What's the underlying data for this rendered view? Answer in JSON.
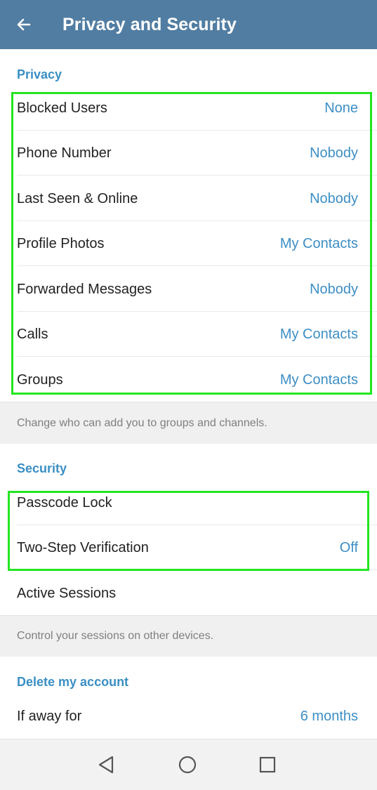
{
  "header": {
    "title": "Privacy and Security",
    "back_icon": "arrow-left-icon"
  },
  "privacy": {
    "title": "Privacy",
    "items": [
      {
        "label": "Blocked Users",
        "value": "None"
      },
      {
        "label": "Phone Number",
        "value": "Nobody"
      },
      {
        "label": "Last Seen & Online",
        "value": "Nobody"
      },
      {
        "label": "Profile Photos",
        "value": "My Contacts"
      },
      {
        "label": "Forwarded Messages",
        "value": "Nobody"
      },
      {
        "label": "Calls",
        "value": "My Contacts"
      },
      {
        "label": "Groups",
        "value": "My Contacts"
      }
    ],
    "footer": "Change who can add you to groups and channels."
  },
  "security": {
    "title": "Security",
    "items": [
      {
        "label": "Passcode Lock",
        "value": ""
      },
      {
        "label": "Two-Step Verification",
        "value": "Off"
      },
      {
        "label": "Active Sessions",
        "value": ""
      }
    ],
    "footer": "Control your sessions on other devices."
  },
  "delete_account": {
    "title": "Delete my account",
    "items": [
      {
        "label": "If away for",
        "value": "6 months"
      }
    ]
  },
  "navbar": {
    "buttons": [
      "back-triangle-icon",
      "home-circle-icon",
      "recents-square-icon"
    ]
  },
  "colors": {
    "header_bg": "#517da2",
    "accent": "#3d8ec5",
    "highlight": "#22e620"
  }
}
